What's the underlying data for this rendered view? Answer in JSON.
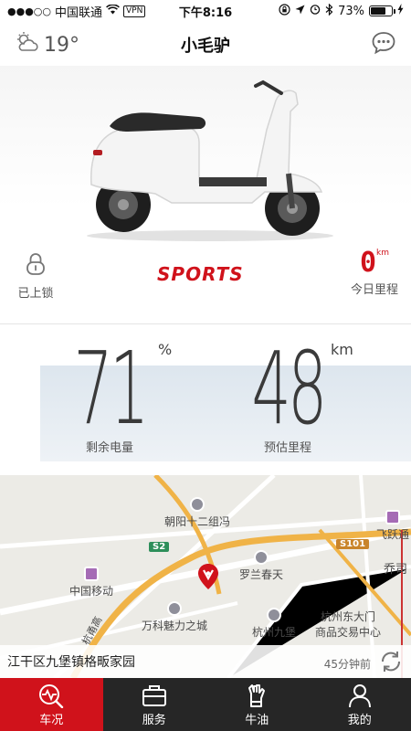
{
  "status_bar": {
    "signal_dots": "●●●○○",
    "carrier": "中国联通",
    "vpn": "VPN",
    "time": "下午8:16",
    "battery_text": "73%",
    "battery_level": 0.73
  },
  "header": {
    "temperature": "19°",
    "title": "小毛驴"
  },
  "hero": {
    "lock_label": "已上锁",
    "mode": "SPORTS",
    "trip_value": "0",
    "trip_unit": "km",
    "trip_label": "今日里程"
  },
  "stats": {
    "battery_value": "71",
    "battery_unit": "%",
    "battery_label": "剩余电量",
    "range_value": "48",
    "range_unit": "km",
    "range_label": "预估里程"
  },
  "map": {
    "pois": {
      "p1": "朝阳十二组冯",
      "p2": "中国移动",
      "p3": "罗兰春天",
      "p4": "万科魅力之城",
      "p5": "杭州九堡",
      "p6": "杭州东大门",
      "p7": "商品交易中心",
      "p8": "乔司",
      "p9": "飞跃通"
    },
    "roads": {
      "s2": "S2",
      "s101": "S101",
      "hw": "杭甬高"
    },
    "address": "江干区九堡镇格畈家园",
    "updated": "45分钟前"
  },
  "tabs": [
    {
      "label": "车况"
    },
    {
      "label": "服务"
    },
    {
      "label": "牛油"
    },
    {
      "label": "我的"
    }
  ],
  "colors": {
    "accent": "#d0121b",
    "tabbar": "#262626"
  }
}
